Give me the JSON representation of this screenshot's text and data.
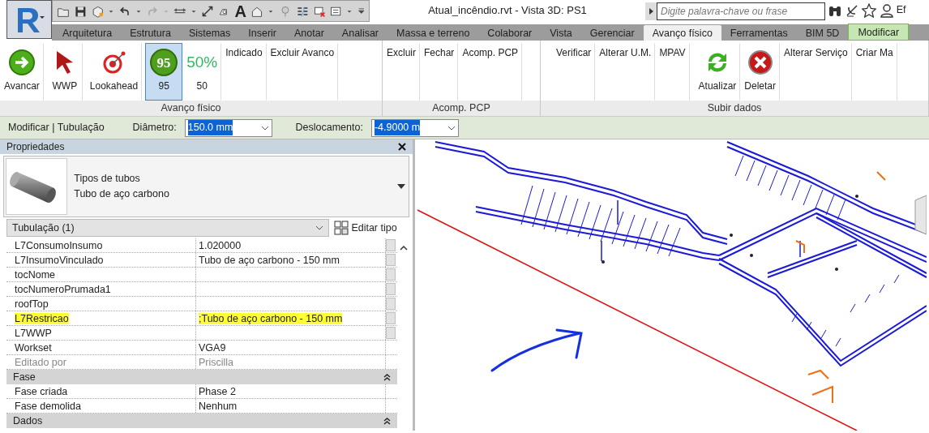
{
  "window": {
    "title": "Atual_incêndio.rvt - Vista 3D: PS1"
  },
  "quick_access": {
    "text_tool_glyph": "A"
  },
  "search": {
    "placeholder": "Digite palavra-chave ou frase"
  },
  "user_label": "Ef",
  "ribbon_tabs": [
    {
      "label": "Arquitetura",
      "selected": false,
      "kind": "normal"
    },
    {
      "label": "Estrutura",
      "selected": false,
      "kind": "normal"
    },
    {
      "label": "Sistemas",
      "selected": false,
      "kind": "normal"
    },
    {
      "label": "Inserir",
      "selected": false,
      "kind": "normal"
    },
    {
      "label": "Anotar",
      "selected": false,
      "kind": "normal"
    },
    {
      "label": "Analisar",
      "selected": false,
      "kind": "normal"
    },
    {
      "label": "Massa e terreno",
      "selected": false,
      "kind": "normal"
    },
    {
      "label": "Colaborar",
      "selected": false,
      "kind": "normal"
    },
    {
      "label": "Vista",
      "selected": false,
      "kind": "normal"
    },
    {
      "label": "Gerenciar",
      "selected": false,
      "kind": "normal"
    },
    {
      "label": "Avanço físico",
      "selected": true,
      "kind": "normal"
    },
    {
      "label": "Ferramentas",
      "selected": false,
      "kind": "normal"
    },
    {
      "label": "BIM 5D",
      "selected": false,
      "kind": "normal"
    },
    {
      "label": "Modificar",
      "selected": false,
      "kind": "contextual"
    }
  ],
  "ribbon_panels": [
    {
      "title": "Avanço físico",
      "buttons": [
        {
          "label": "Avancar",
          "kind": "arrow",
          "selected": false
        },
        {
          "label": "WWP",
          "kind": "cursor",
          "selected": false
        },
        {
          "label": "Lookahead",
          "kind": "target",
          "selected": false
        },
        {
          "label": "95",
          "kind": "badge",
          "icon_text": "95",
          "selected": true
        },
        {
          "label": "50",
          "kind": "percent",
          "icon_text": "50%",
          "selected": false
        },
        {
          "label": "Indicado",
          "kind": "text",
          "selected": false
        },
        {
          "label": "Excluir Avanco",
          "kind": "text",
          "selected": false
        }
      ]
    },
    {
      "title": "Acomp. PCP",
      "buttons": [
        {
          "label": "Excluir",
          "kind": "text",
          "selected": false
        },
        {
          "label": "Fechar",
          "kind": "text",
          "selected": false
        },
        {
          "label": "Acomp. PCP",
          "kind": "text",
          "selected": false
        }
      ]
    },
    {
      "title": "Subir dados",
      "buttons": [
        {
          "label": "Verificar",
          "kind": "text",
          "selected": false
        },
        {
          "label": "Alterar U.M.",
          "kind": "text",
          "selected": false
        },
        {
          "label": "MPAV",
          "kind": "text",
          "selected": false
        },
        {
          "label": "Atualizar",
          "kind": "refresh",
          "selected": false
        },
        {
          "label": "Deletar",
          "kind": "delete",
          "selected": false
        },
        {
          "label": "Alterar Serviço",
          "kind": "text",
          "selected": false
        },
        {
          "label": "Criar Ma",
          "kind": "text",
          "selected": false
        }
      ]
    }
  ],
  "options_bar": {
    "context": "Modificar | Tubulação",
    "fields": [
      {
        "label": "Diâmetro:",
        "value": "150.0 mm",
        "text_selected": true
      },
      {
        "label": "Deslocamento:",
        "value": "-4.9000 m",
        "text_selected": true
      }
    ]
  },
  "properties": {
    "title": "Propriedades",
    "type_family": "Tipos de tubos",
    "type_name": "Tubo de aço carbono",
    "filter": "Tubulação (1)",
    "edit_type_button": "Editar tipo",
    "rows": [
      {
        "kind": "param",
        "name": "L7ConsumoInsumo",
        "value": "1.020000",
        "highlighted": false,
        "disabled": false
      },
      {
        "kind": "param",
        "name": "L7InsumoVinculado",
        "value": "Tubo de aço carbono - 150 mm",
        "highlighted": false,
        "disabled": false
      },
      {
        "kind": "param",
        "name": "tocNome",
        "highlighted": false,
        "disabled": false
      },
      {
        "kind": "param",
        "name": "tocNumeroPrumada1",
        "highlighted": false,
        "disabled": false
      },
      {
        "kind": "param",
        "name": "roofTop",
        "highlighted": false,
        "disabled": false
      },
      {
        "kind": "param",
        "name": "L7Restricao",
        "value": ";Tubo de aço carbono - 150 mm",
        "highlighted": true,
        "disabled": false
      },
      {
        "kind": "param",
        "name": "L7WWP",
        "highlighted": false,
        "disabled": false
      },
      {
        "kind": "param",
        "name": "Workset",
        "value": "VGA9",
        "highlighted": false,
        "disabled": false
      },
      {
        "kind": "param",
        "name": "Editado por",
        "value": "Priscilla",
        "highlighted": false,
        "disabled": true
      },
      {
        "kind": "group",
        "name": "Fase",
        "expanded": true
      },
      {
        "kind": "param",
        "name": "Fase criada",
        "value": "Phase 2",
        "highlighted": false,
        "disabled": false
      },
      {
        "kind": "param",
        "name": "Fase demolida",
        "value": "Nenhum",
        "highlighted": false,
        "disabled": false
      },
      {
        "kind": "group",
        "name": "Dados",
        "expanded": true
      }
    ]
  }
}
